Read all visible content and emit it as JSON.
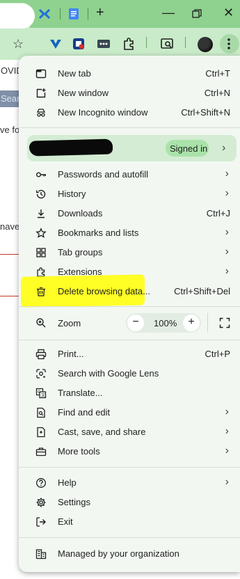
{
  "menu": {
    "new_tab": {
      "label": "New tab",
      "shortcut": "Ctrl+T"
    },
    "new_window": {
      "label": "New window",
      "shortcut": "Ctrl+N"
    },
    "new_incognito": {
      "label": "New Incognito window",
      "shortcut": "Ctrl+Shift+N"
    },
    "profile": {
      "status": "Signed in"
    },
    "passwords": {
      "label": "Passwords and autofill"
    },
    "history": {
      "label": "History"
    },
    "downloads": {
      "label": "Downloads",
      "shortcut": "Ctrl+J"
    },
    "bookmarks": {
      "label": "Bookmarks and lists"
    },
    "tab_groups": {
      "label": "Tab groups"
    },
    "extensions": {
      "label": "Extensions"
    },
    "delete_data": {
      "label": "Delete browsing data...",
      "shortcut": "Ctrl+Shift+Del"
    },
    "zoom": {
      "label": "Zoom",
      "value": "100%",
      "minus": "−",
      "plus": "+"
    },
    "print": {
      "label": "Print...",
      "shortcut": "Ctrl+P"
    },
    "lens": {
      "label": "Search with Google Lens"
    },
    "translate": {
      "label": "Translate..."
    },
    "find_edit": {
      "label": "Find and edit"
    },
    "cast_save": {
      "label": "Cast, save, and share"
    },
    "more_tools": {
      "label": "More tools"
    },
    "help": {
      "label": "Help"
    },
    "settings": {
      "label": "Settings"
    },
    "exit": {
      "label": "Exit"
    },
    "managed": {
      "label": "Managed by your organization"
    }
  },
  "background_page": {
    "fragment_1": "OVID",
    "fragment_2": "Searc",
    "fragment_3": "ve fo",
    "fragment_4": "nave"
  },
  "colors": {
    "titlebar": "#8fd18f",
    "toolbar": "#c9ebc9",
    "menu_bg": "#f2f7f2",
    "highlight": "#ffff1a"
  }
}
